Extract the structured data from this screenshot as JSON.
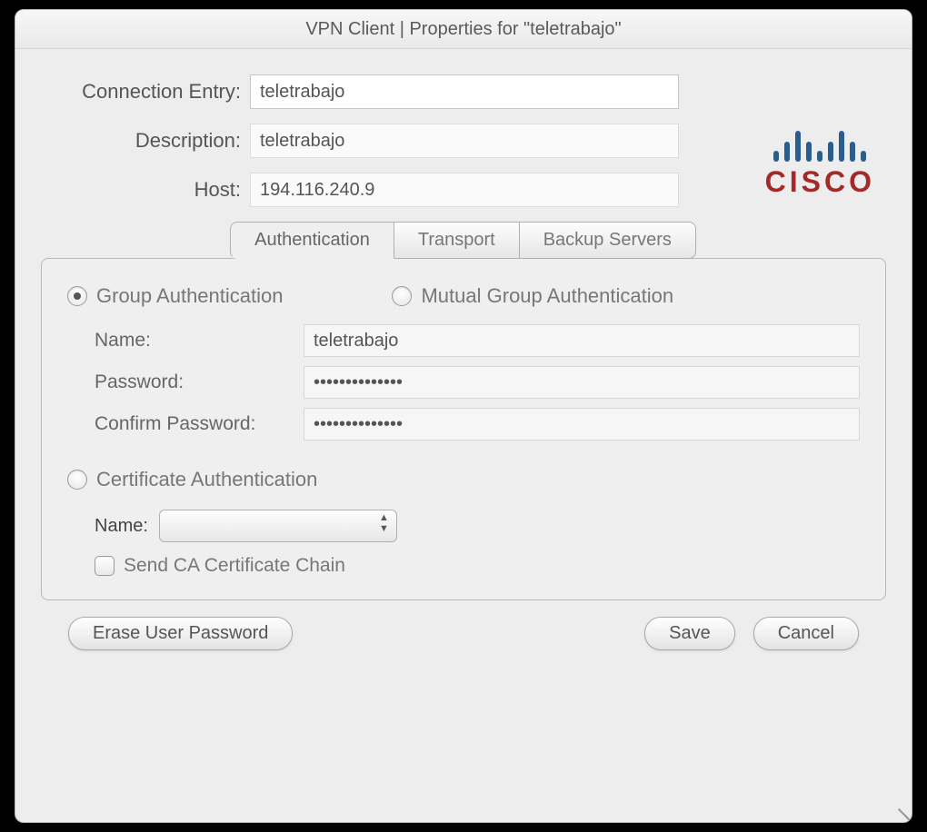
{
  "title": "VPN Client   |   Properties for \"teletrabajo\"",
  "logo": {
    "text": "CISCO"
  },
  "fields": {
    "connection_entry_label": "Connection Entry:",
    "connection_entry_value": "teletrabajo",
    "description_label": "Description:",
    "description_value": "teletrabajo",
    "host_label": "Host:",
    "host_value": "194.116.240.9"
  },
  "tabs": {
    "auth": "Authentication",
    "transport": "Transport",
    "backup": "Backup Servers"
  },
  "auth": {
    "group_auth_label": "Group Authentication",
    "mutual_auth_label": "Mutual Group Authentication",
    "name_label": "Name:",
    "name_value": "teletrabajo",
    "password_label": "Password:",
    "password_value": "••••••••••••••",
    "confirm_label": "Confirm Password:",
    "confirm_value": "••••••••••••••",
    "cert_auth_label": "Certificate Authentication",
    "cert_name_label": "Name:",
    "cert_chain_label": "Send CA Certificate Chain"
  },
  "buttons": {
    "erase": "Erase User Password",
    "save": "Save",
    "cancel": "Cancel"
  }
}
